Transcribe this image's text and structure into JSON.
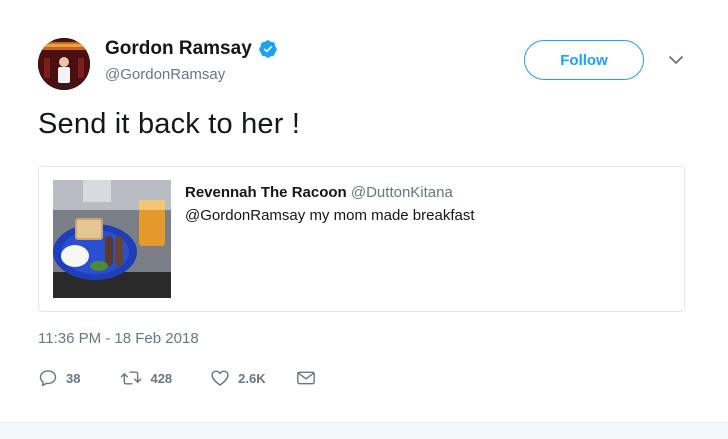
{
  "author": {
    "name": "Gordon Ramsay",
    "handle": "@GordonRamsay",
    "verified": true,
    "verified_icon": "verified-badge-icon",
    "avatar_icon": "avatar-photo"
  },
  "follow": {
    "label": "Follow"
  },
  "menu": {
    "icon": "chevron-down-icon"
  },
  "tweet": {
    "text": "Send it back to her !"
  },
  "quote": {
    "name": "Revennah The Racoon",
    "handle": "@DuttonKitana",
    "text": "@GordonRamsay my mom made breakfast",
    "image_icon": "breakfast-plate-photo"
  },
  "timestamp": "11:36 PM - 18 Feb 2018",
  "actions": {
    "reply": {
      "icon": "reply-icon",
      "count": "38"
    },
    "retweet": {
      "icon": "retweet-icon",
      "count": "428"
    },
    "like": {
      "icon": "heart-icon",
      "count": "2.6K"
    },
    "message": {
      "icon": "envelope-icon"
    }
  },
  "colors": {
    "accent": "#1da1f2",
    "text": "#14171a",
    "muted": "#657786",
    "border": "#e1e8ed"
  }
}
